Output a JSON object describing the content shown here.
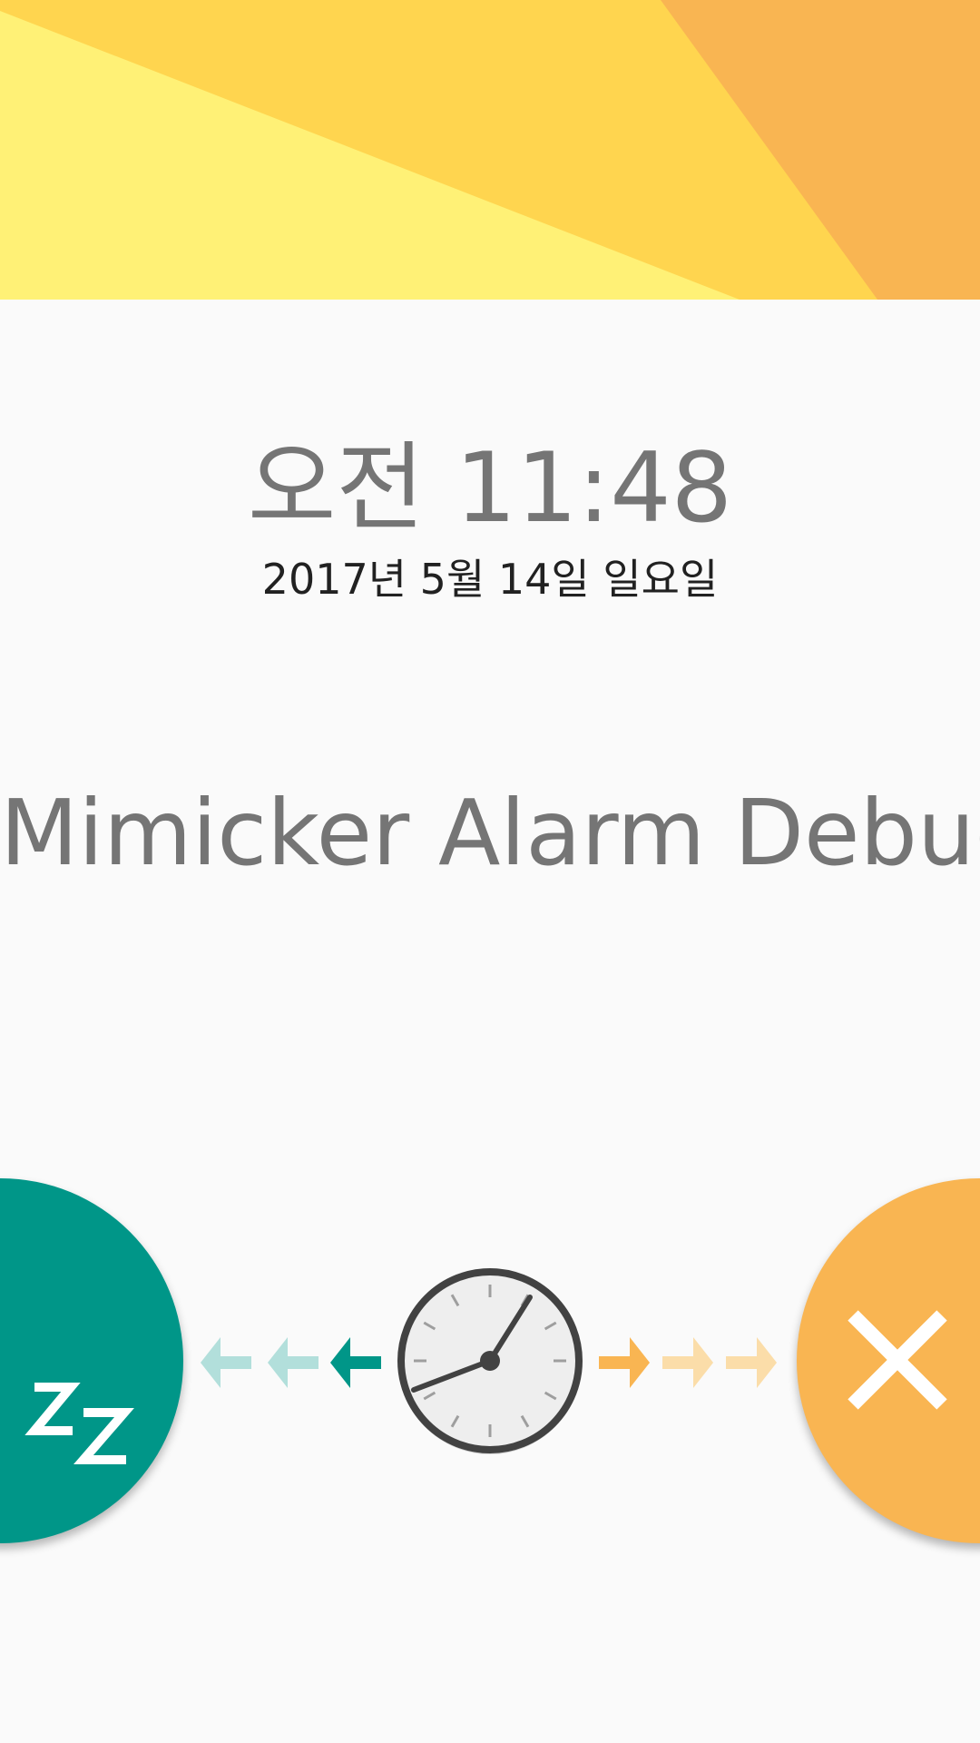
{
  "header": {
    "colors": {
      "light": "#FFF176",
      "mid": "#FFD54F",
      "dark": "#F9B552"
    }
  },
  "alarm": {
    "time": "오전 11:48",
    "date": "2017년 5월 14일 일요일",
    "title": "Mimicker Alarm Debug"
  },
  "controls": {
    "snooze": {
      "icon": "snooze-zz-icon",
      "color": "#009688"
    },
    "dismiss": {
      "icon": "close-x-icon",
      "color": "#F9B552"
    },
    "handle": {
      "icon": "clock-icon"
    },
    "left_arrows": {
      "icon": "arrow-left-icon",
      "color": "#009688"
    },
    "right_arrows": {
      "icon": "arrow-right-icon",
      "color": "#F9B552"
    }
  }
}
